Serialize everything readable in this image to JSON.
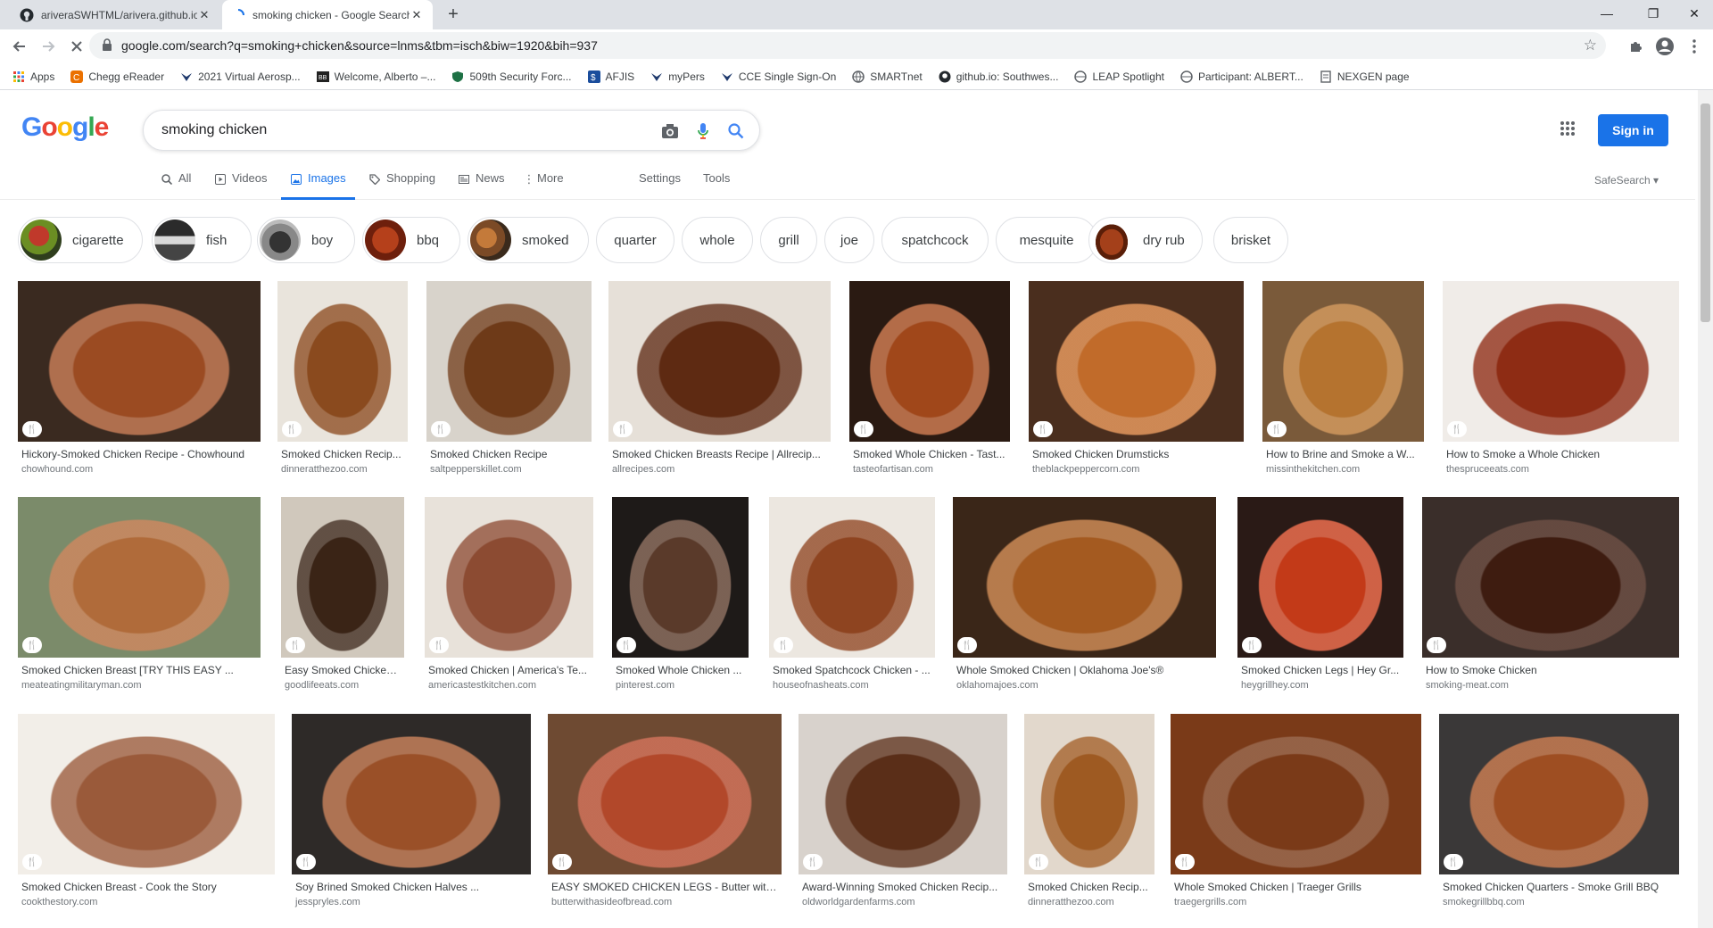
{
  "browser": {
    "tabs": [
      {
        "title": "ariveraSWHTML/arivera.github.io",
        "icon": "github-icon"
      },
      {
        "title": "smoking chicken - Google Search",
        "icon": "loading-icon"
      }
    ],
    "url": "google.com/search?q=smoking+chicken&source=lnms&tbm=isch&biw=1920&bih=937",
    "bookmarks": [
      "Apps",
      "Chegg eReader",
      "2021 Virtual Aerosp...",
      "Welcome, Alberto –...",
      "509th Security Forc...",
      "AFJIS",
      "myPers",
      "CCE Single Sign-On",
      "SMARTnet",
      "github.io: Southwes...",
      "LEAP Spotlight",
      "Participant: ALBERT...",
      "NEXGEN page"
    ]
  },
  "google": {
    "query": "smoking chicken",
    "sign_in": "Sign in",
    "nav": {
      "all": "All",
      "videos": "Videos",
      "images": "Images",
      "shopping": "Shopping",
      "news": "News",
      "more": "More",
      "settings": "Settings",
      "tools": "Tools"
    },
    "safesearch": "SafeSearch ▾",
    "chips": [
      "cigarette",
      "fish",
      "boy",
      "bbq",
      "smoked",
      "quarter",
      "whole",
      "grill",
      "joe",
      "spatchcock",
      "mesquite",
      "dry rub",
      "brisket"
    ],
    "results": [
      {
        "title": "Hickory-Smoked Chicken Recipe - Chowhound",
        "source": "chowhound.com"
      },
      {
        "title": "Smoked Chicken Recip...",
        "source": "dinneratthezoo.com"
      },
      {
        "title": "Smoked Chicken Recipe",
        "source": "saltpepperskillet.com"
      },
      {
        "title": "Smoked Chicken Breasts Recipe | Allrecip...",
        "source": "allrecipes.com"
      },
      {
        "title": "Smoked Whole Chicken - Tast...",
        "source": "tasteofartisan.com"
      },
      {
        "title": "Smoked Chicken Drumsticks",
        "source": "theblackpeppercorn.com"
      },
      {
        "title": "How to Brine and Smoke a W...",
        "source": "missinthekitchen.com"
      },
      {
        "title": "How to Smoke a Whole Chicken",
        "source": "thespruceeats.com"
      },
      {
        "title": "Smoked Chicken Breast [TRY THIS EASY ...",
        "source": "meateatingmilitaryman.com"
      },
      {
        "title": "Easy Smoked Chicken ...",
        "source": "goodlifeeats.com"
      },
      {
        "title": "Smoked Chicken | America's Te...",
        "source": "americastestkitchen.com"
      },
      {
        "title": "Smoked Whole Chicken ...",
        "source": "pinterest.com"
      },
      {
        "title": "Smoked Spatchcock Chicken - ...",
        "source": "houseofnasheats.com"
      },
      {
        "title": "Whole Smoked Chicken | Oklahoma Joe's®",
        "source": "oklahomajoes.com"
      },
      {
        "title": "Smoked Chicken Legs | Hey Gr...",
        "source": "heygrillhey.com"
      },
      {
        "title": "How to Smoke Chicken",
        "source": "smoking-meat.com"
      },
      {
        "title": "Smoked Chicken Breast - Cook the Story",
        "source": "cookthestory.com"
      },
      {
        "title": "Soy Brined Smoked Chicken Halves ...",
        "source": "jesspryles.com"
      },
      {
        "title": "EASY SMOKED CHICKEN LEGS - Butter with ...",
        "source": "butterwithasideofbread.com"
      },
      {
        "title": "Award-Winning Smoked Chicken Recip...",
        "source": "oldworldgardenfarms.com"
      },
      {
        "title": "Smoked Chicken Recip...",
        "source": "dinneratthezoo.com"
      },
      {
        "title": "Whole Smoked Chicken | Traeger Grills",
        "source": "traegergrills.com"
      },
      {
        "title": "Smoked Chicken Quarters - Smoke Grill BBQ",
        "source": "smokegrillbbq.com"
      }
    ]
  },
  "colors": {
    "accent": "#1a73e8",
    "google_blue": "#4285f4",
    "google_red": "#ea4335",
    "google_yellow": "#fbbc05",
    "google_green": "#34a853"
  }
}
